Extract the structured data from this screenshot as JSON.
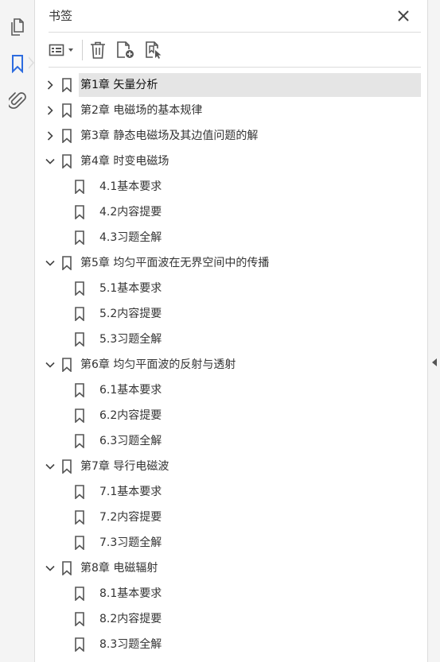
{
  "rail": {
    "icons": [
      "pages-icon",
      "bookmarks-icon",
      "attachments-icon"
    ],
    "active": "bookmarks-icon",
    "active_color": "#2d6cdf"
  },
  "panel": {
    "title": "书签",
    "close_icon": "close-icon",
    "toolbar": {
      "options_icon": "list-options-icon",
      "dropdown_icon": "caret-down-icon",
      "delete_icon": "trash-icon",
      "new_bookmark_icon": "add-bookmark-icon",
      "search_bookmark_icon": "find-bookmark-icon"
    }
  },
  "bookmarks": [
    {
      "label": "第1章  矢量分析",
      "level": 0,
      "state": "collapsed",
      "selected": true
    },
    {
      "label": "第2章  电磁场的基本规律",
      "level": 0,
      "state": "collapsed"
    },
    {
      "label": "第3章  静态电磁场及其边值问题的解",
      "level": 0,
      "state": "collapsed"
    },
    {
      "label": "第4章  时变电磁场",
      "level": 0,
      "state": "expanded"
    },
    {
      "label": "4.1基本要求",
      "level": 1
    },
    {
      "label": "4.2内容提要",
      "level": 1
    },
    {
      "label": "4.3习题全解",
      "level": 1
    },
    {
      "label": "第5章  均匀平面波在无界空间中的传播",
      "level": 0,
      "state": "expanded"
    },
    {
      "label": "5.1基本要求",
      "level": 1
    },
    {
      "label": "5.2内容提要",
      "level": 1
    },
    {
      "label": "5.3习题全解",
      "level": 1
    },
    {
      "label": "第6章  均匀平面波的反射与透射",
      "level": 0,
      "state": "expanded"
    },
    {
      "label": "6.1基本要求",
      "level": 1
    },
    {
      "label": "6.2内容提要",
      "level": 1
    },
    {
      "label": "6.3习题全解",
      "level": 1
    },
    {
      "label": "第7章  导行电磁波",
      "level": 0,
      "state": "expanded"
    },
    {
      "label": "7.1基本要求",
      "level": 1
    },
    {
      "label": "7.2内容提要",
      "level": 1
    },
    {
      "label": "7.3习题全解",
      "level": 1
    },
    {
      "label": "第8章  电磁辐射",
      "level": 0,
      "state": "expanded"
    },
    {
      "label": "8.1基本要求",
      "level": 1
    },
    {
      "label": "8.2内容提要",
      "level": 1
    },
    {
      "label": "8.3习题全解",
      "level": 1
    }
  ],
  "collapse_panel_icon": "caret-left-icon"
}
